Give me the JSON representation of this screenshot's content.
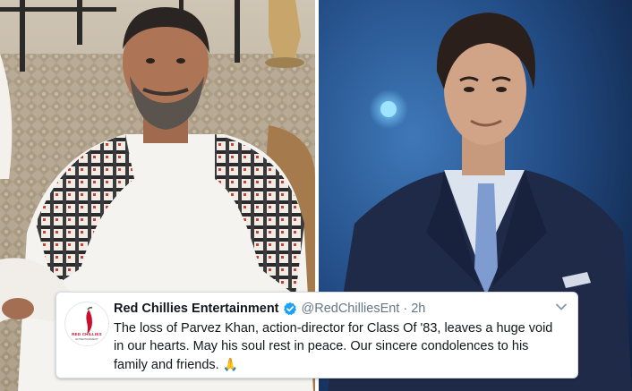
{
  "tweet": {
    "author_name": "Red Chillies Entertainment",
    "handle": "@RedChilliesEnt",
    "separator": "·",
    "time": "2h",
    "text_lines": [
      "The loss of Parvez Khan, action-director for Class Of '83, leaves a huge void",
      "in our hearts. May his soul rest in peace. Our sincere condolences to his",
      "family and friends."
    ],
    "emoji": "🙏",
    "avatar_logo_text": "RED CHILLIES",
    "avatar_logo_subtext": "ENTERTAINMENT"
  },
  "colors": {
    "verified_badge": "#1da1f2",
    "handle_text": "#657786",
    "name_text": "#14171a",
    "logo_red": "#c8102e"
  },
  "icons": [
    "verified-badge-icon",
    "chevron-down-icon",
    "red-chili-logo-icon"
  ]
}
